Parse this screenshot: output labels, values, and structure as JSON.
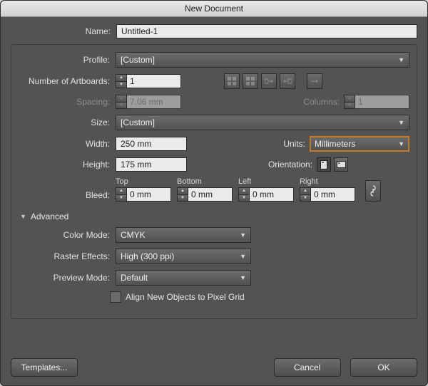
{
  "title": "New Document",
  "name": {
    "label": "Name:",
    "value": "Untitled-1"
  },
  "profile": {
    "label": "Profile:",
    "value": "[Custom]"
  },
  "artboards": {
    "label": "Number of Artboards:",
    "value": "1"
  },
  "spacing": {
    "label": "Spacing:",
    "value": "7.06 mm"
  },
  "columns": {
    "label": "Columns:",
    "value": "1"
  },
  "size": {
    "label": "Size:",
    "value": "[Custom]"
  },
  "width": {
    "label": "Width:",
    "value": "250 mm"
  },
  "units": {
    "label": "Units:",
    "value": "Millimeters"
  },
  "height": {
    "label": "Height:",
    "value": "175 mm"
  },
  "orientation": {
    "label": "Orientation:"
  },
  "bleed": {
    "label": "Bleed:",
    "top": {
      "label": "Top",
      "value": "0 mm"
    },
    "bottom": {
      "label": "Bottom",
      "value": "0 mm"
    },
    "left": {
      "label": "Left",
      "value": "0 mm"
    },
    "right": {
      "label": "Right",
      "value": "0 mm"
    }
  },
  "advanced": {
    "label": "Advanced",
    "color_mode": {
      "label": "Color Mode:",
      "value": "CMYK"
    },
    "raster": {
      "label": "Raster Effects:",
      "value": "High (300 ppi)"
    },
    "preview_mode": {
      "label": "Preview Mode:",
      "value": "Default"
    },
    "align_grid": {
      "label": "Align New Objects to Pixel Grid"
    }
  },
  "footer": {
    "templates": "Templates...",
    "cancel": "Cancel",
    "ok": "OK"
  }
}
